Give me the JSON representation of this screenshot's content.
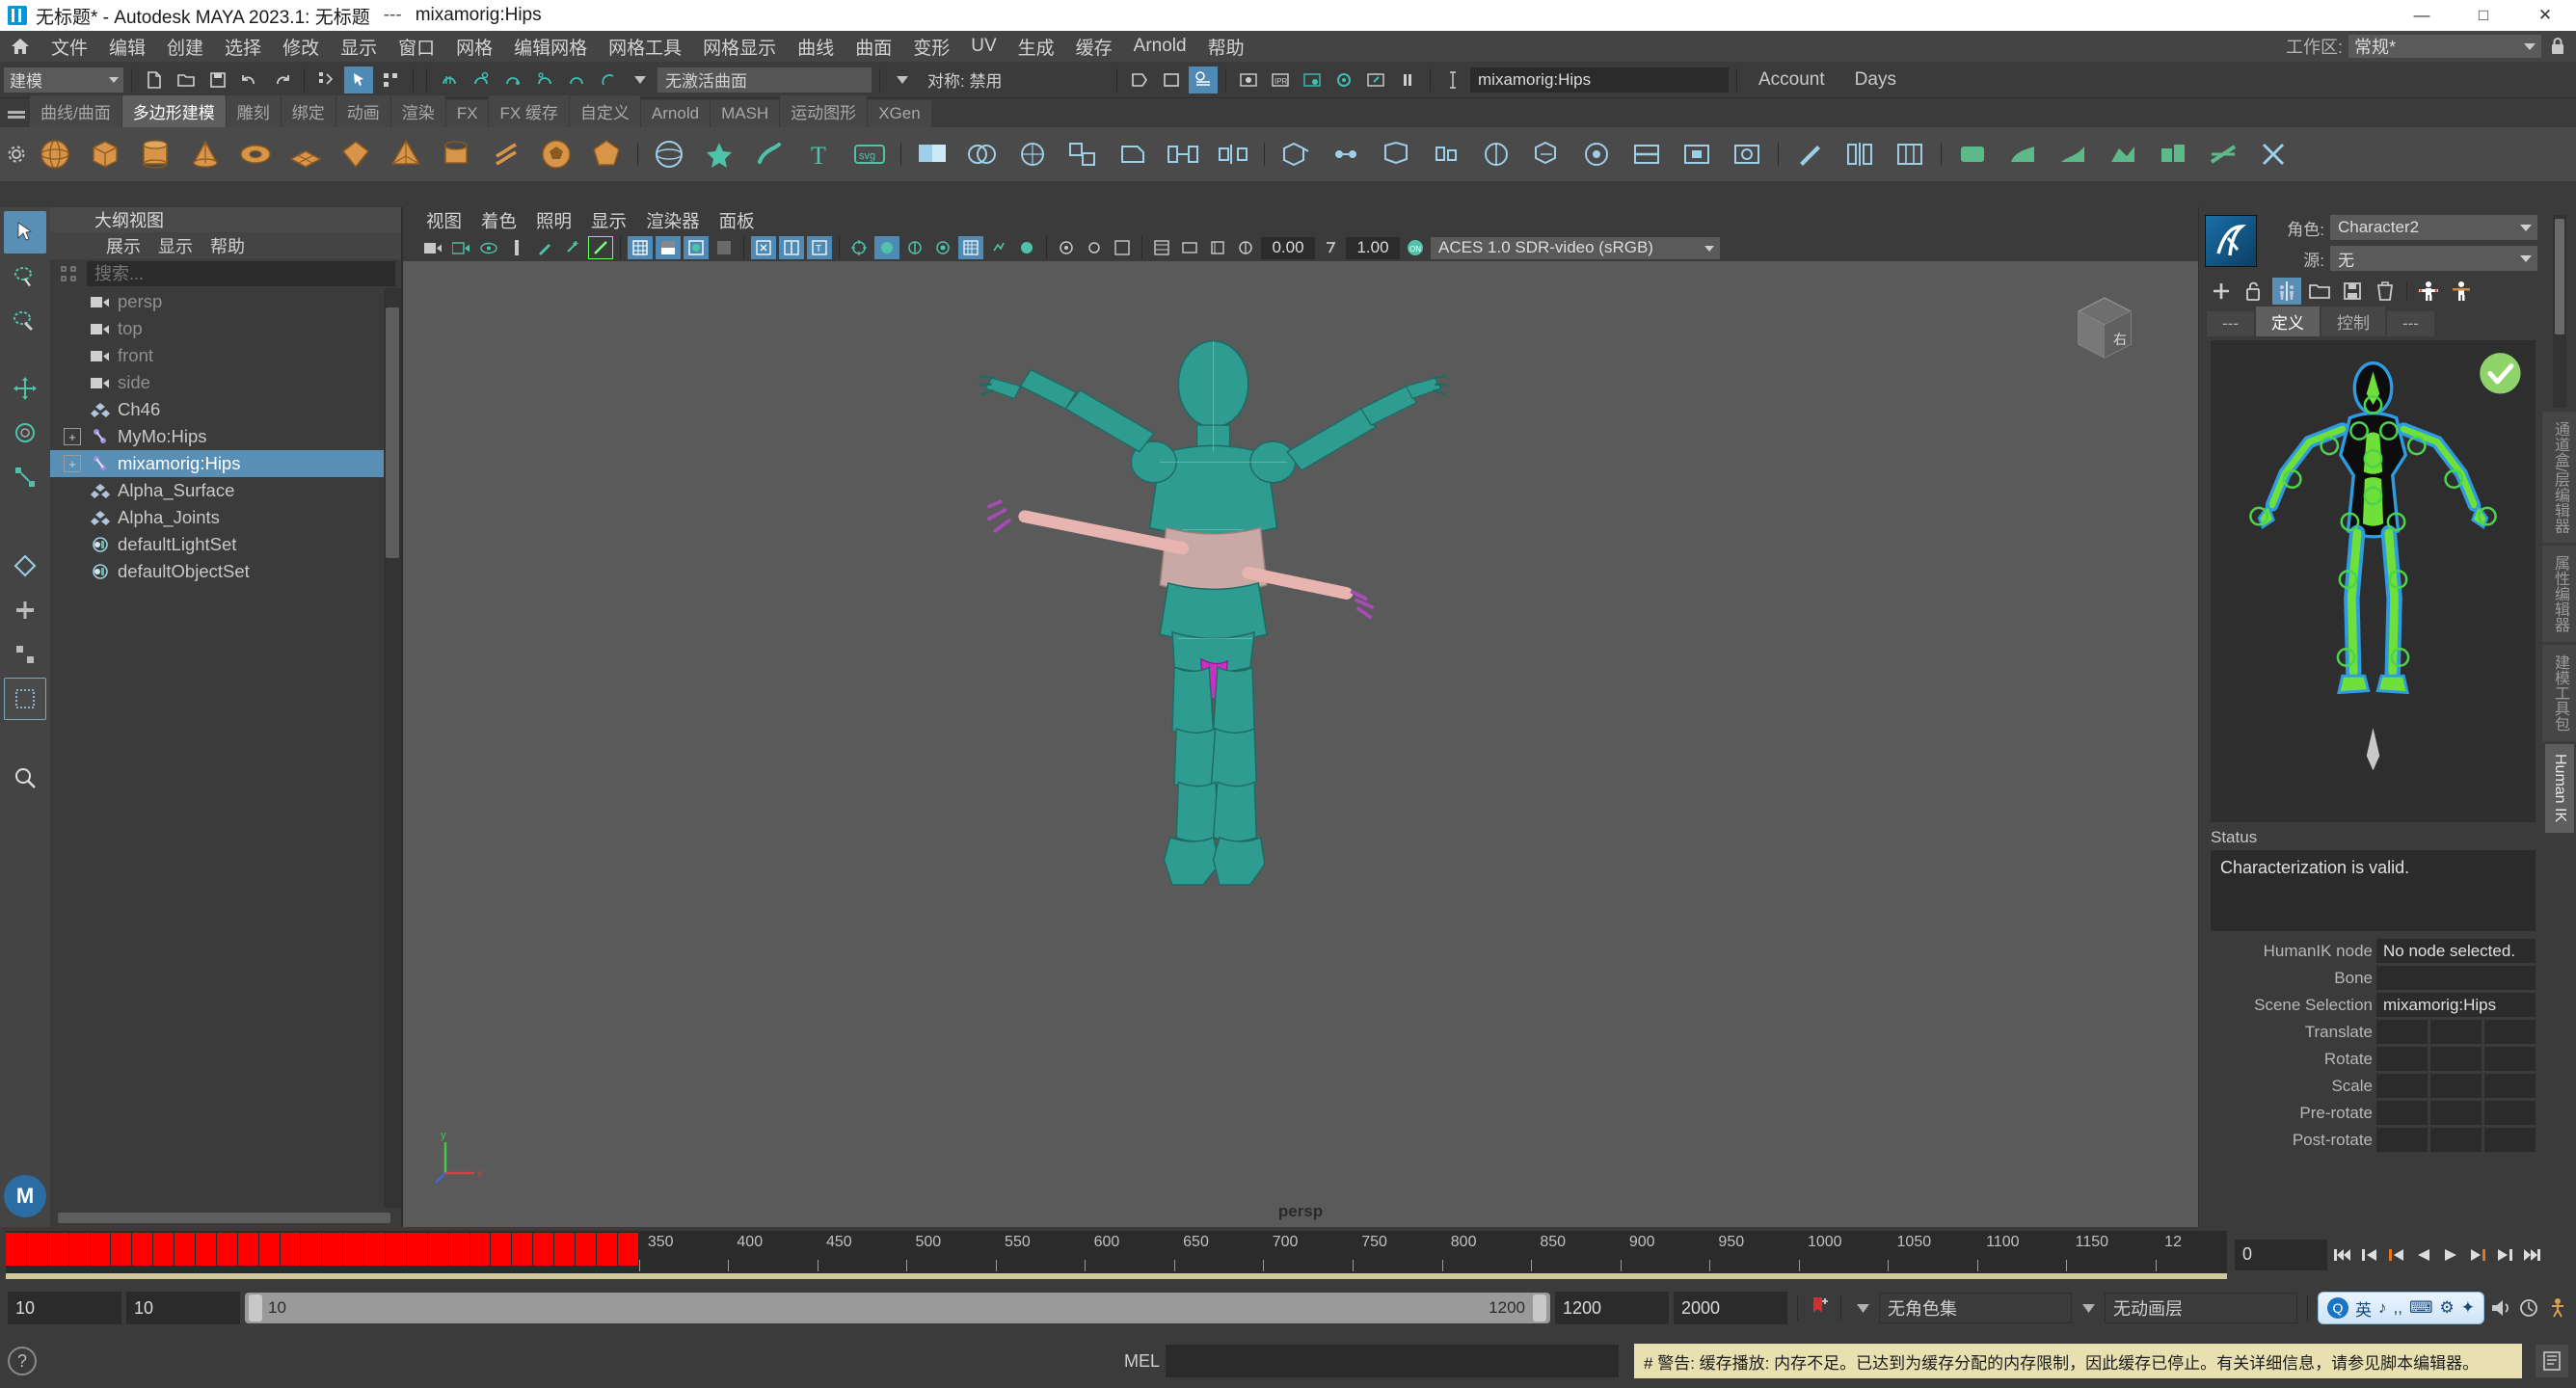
{
  "titlebar": {
    "title": "无标题* - Autodesk MAYA 2023.1: 无标题",
    "separator": "---",
    "selection": "mixamorig:Hips",
    "minimize": "—",
    "maximize": "□",
    "close": "✕"
  },
  "menubar": {
    "items": [
      "文件",
      "编辑",
      "创建",
      "选择",
      "修改",
      "显示",
      "窗口",
      "网格",
      "编辑网格",
      "网格工具",
      "网格显示",
      "曲线",
      "曲面",
      "变形",
      "UV",
      "生成",
      "缓存",
      "Arnold",
      "帮助"
    ],
    "workspace_label": "工作区:",
    "workspace_value": "常规*"
  },
  "statusline": {
    "mode": "建模",
    "surface_field": "无激活曲面",
    "symmetry_field": "对称: 禁用",
    "selection_field": "mixamorig:Hips",
    "account": "Account",
    "days": "Days"
  },
  "shelf": {
    "tabs": [
      "曲线/曲面",
      "多边形建模",
      "雕刻",
      "绑定",
      "动画",
      "渲染",
      "FX",
      "FX 缓存",
      "自定义",
      "Arnold",
      "MASH",
      "运动图形",
      "XGen"
    ],
    "selected_tab": "多边形建模"
  },
  "outliner": {
    "title": "大纲视图",
    "menus": [
      "展示",
      "显示",
      "帮助"
    ],
    "search_placeholder": "搜索...",
    "items": [
      {
        "label": "persp",
        "icon": "camera-icon",
        "dim": true,
        "expander": false,
        "selected": false
      },
      {
        "label": "top",
        "icon": "camera-icon",
        "dim": true,
        "expander": false,
        "selected": false
      },
      {
        "label": "front",
        "icon": "camera-icon",
        "dim": true,
        "expander": false,
        "selected": false
      },
      {
        "label": "side",
        "icon": "camera-icon",
        "dim": true,
        "expander": false,
        "selected": false
      },
      {
        "label": "Ch46",
        "icon": "transform-icon",
        "dim": false,
        "expander": false,
        "selected": false
      },
      {
        "label": "MyMo:Hips",
        "icon": "joint-icon",
        "dim": false,
        "expander": true,
        "selected": false
      },
      {
        "label": "mixamorig:Hips",
        "icon": "joint-icon",
        "dim": false,
        "expander": true,
        "selected": true
      },
      {
        "label": "Alpha_Surface",
        "icon": "transform-icon",
        "dim": false,
        "expander": false,
        "selected": false
      },
      {
        "label": "Alpha_Joints",
        "icon": "transform-icon",
        "dim": false,
        "expander": false,
        "selected": false
      },
      {
        "label": "defaultLightSet",
        "icon": "set-icon",
        "dim": false,
        "expander": false,
        "selected": false
      },
      {
        "label": "defaultObjectSet",
        "icon": "set-icon",
        "dim": false,
        "expander": false,
        "selected": false
      }
    ]
  },
  "viewport": {
    "menus": [
      "视图",
      "着色",
      "照明",
      "显示",
      "渲染器",
      "面板"
    ],
    "exposure": "0.00",
    "gamma": "1.00",
    "color_profile": "ACES 1.0 SDR-video (sRGB)",
    "camera_label": "persp"
  },
  "humanik": {
    "character_label": "角色:",
    "character_value": "Character2",
    "source_label": "源:",
    "source_value": "无",
    "tabs": [
      "---",
      "定义",
      "控制",
      "---"
    ],
    "selected_tab": "定义",
    "status_title": "Status",
    "status_message": "Characterization is valid.",
    "fields": [
      {
        "label": "HumanIK node",
        "value": "No node selected.",
        "type": "single"
      },
      {
        "label": "Bone",
        "value": "",
        "type": "single"
      },
      {
        "label": "Scene Selection",
        "value": "mixamorig:Hips",
        "type": "single"
      },
      {
        "label": "Translate",
        "value": "",
        "type": "triple"
      },
      {
        "label": "Rotate",
        "value": "",
        "type": "triple"
      },
      {
        "label": "Scale",
        "value": "",
        "type": "triple"
      },
      {
        "label": "Pre-rotate",
        "value": "",
        "type": "triple"
      },
      {
        "label": "Post-rotate",
        "value": "",
        "type": "triple"
      }
    ],
    "valid_badge": "✓"
  },
  "right_tabs": {
    "items": [
      "通道盒/层编辑器",
      "属性编辑器",
      "建模工具包",
      "Human IK"
    ],
    "selected": "Human IK"
  },
  "timeline": {
    "tick_labels": [
      "350",
      "400",
      "450",
      "500",
      "550",
      "600",
      "650",
      "700",
      "750",
      "800",
      "850",
      "900",
      "950",
      "1000",
      "1050",
      "1100",
      "1150",
      "12"
    ],
    "current_frame": "0",
    "keyframe_end_percent": 28.5
  },
  "rangebar": {
    "start_field": "10",
    "anim_start_field": "10",
    "range_start": "10",
    "range_end": "1200",
    "playback_end": "1200",
    "anim_end": "2000",
    "character_set": "无角色集",
    "anim_layer": "无动画层",
    "ime_language": "英"
  },
  "commandline": {
    "mel_label": "MEL",
    "warning": "# 警告: 缓存播放: 内存不足。已达到为缓存分配的内存限制，因此缓存已停止。有关详细信息，请参见脚本编辑器。"
  },
  "colors": {
    "accent": "#5a8fb5",
    "keyframe_red": "#ff0000",
    "warning_bg": "#e8e0b0",
    "valid_green": "#8ed468",
    "panel_bg": "#3b3b3b",
    "viewport_bg": "#5a5a5a",
    "mesh_teal": "#2f9c91"
  }
}
